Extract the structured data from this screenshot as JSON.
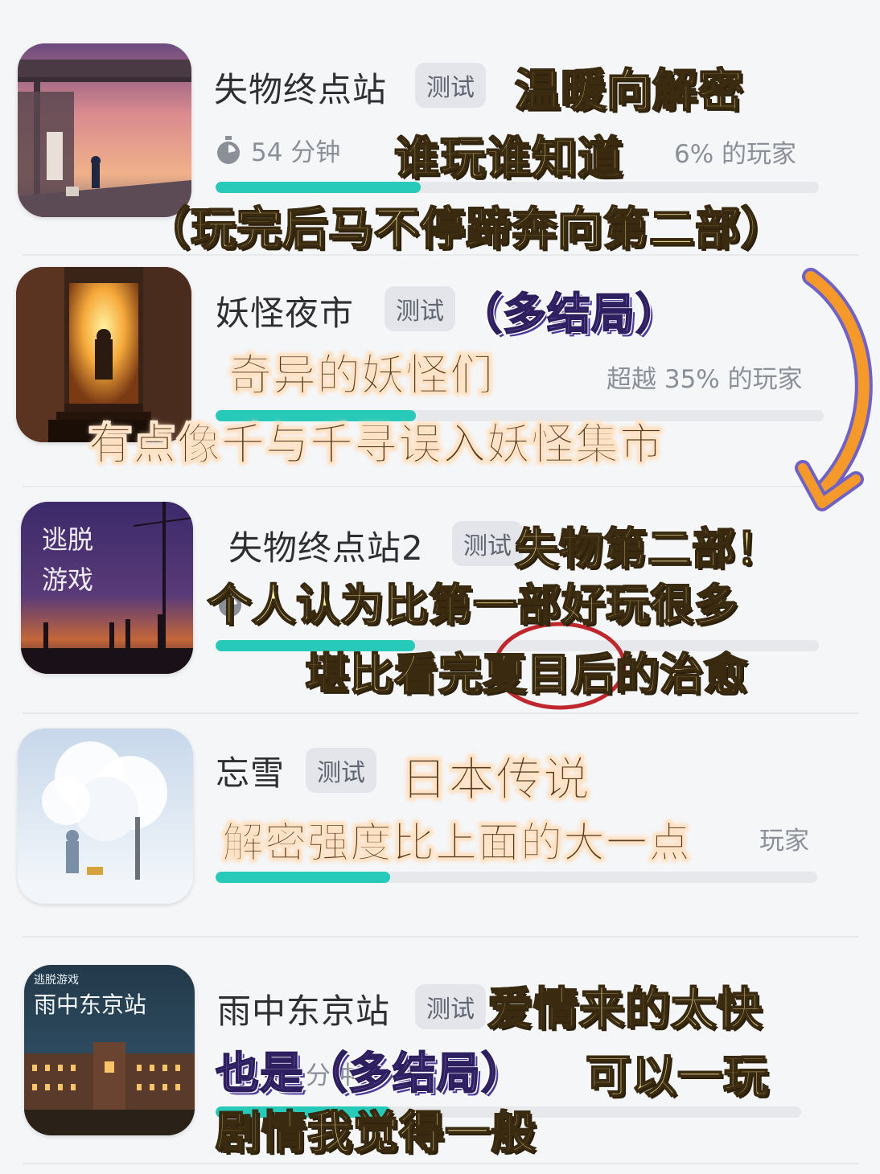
{
  "games": [
    {
      "title": "失物终点站",
      "badge": "测试",
      "duration": "54 分钟",
      "percent": "超越 36% 的玩家",
      "percent_visible": "6% 的玩家",
      "progress": 0.34
    },
    {
      "title": "妖怪夜市",
      "badge": "测试",
      "percent": "超越 35% 的玩家",
      "progress": 0.33
    },
    {
      "title": "失物终点站2",
      "badge": "测试",
      "cover_text": [
        "逃脱",
        "游戏"
      ],
      "progress": 0.33
    },
    {
      "title": "忘雪",
      "badge": "测试",
      "percent_visible": "玩家",
      "progress": 0.29
    },
    {
      "title": "雨中东京站",
      "badge": "测试",
      "cover_small": "逃脱游戏",
      "cover_title": "雨中东京站",
      "duration_visible": "分钟",
      "progress": 0.3
    }
  ],
  "annotations": {
    "a1": "温暖向解密",
    "a2": "谁玩谁知道",
    "a3": "（玩完后马不停蹄奔向第二部）",
    "b1": "（多结局）",
    "b2": "奇异的妖怪们",
    "b3": "有点像千与千寻误入妖怪集市",
    "c1": "失物第二部！",
    "c2": "个人认为比第一部好玩很多",
    "c3": "堪比看完夏目后的治愈",
    "d1": "日本传说",
    "d2": "解密强度比上面的大一点",
    "e1": "爱情来的太快",
    "e2a": "也是（多结局）",
    "e2b": "可以一玩",
    "e3": "剧情我觉得一般"
  },
  "colors": {
    "progress": "#27c9b8",
    "annotation_yellow": "#fbf1a4",
    "annotation_purple": "#9c83e6",
    "arrow": "#f59a2a",
    "circle": "#c0272d"
  }
}
